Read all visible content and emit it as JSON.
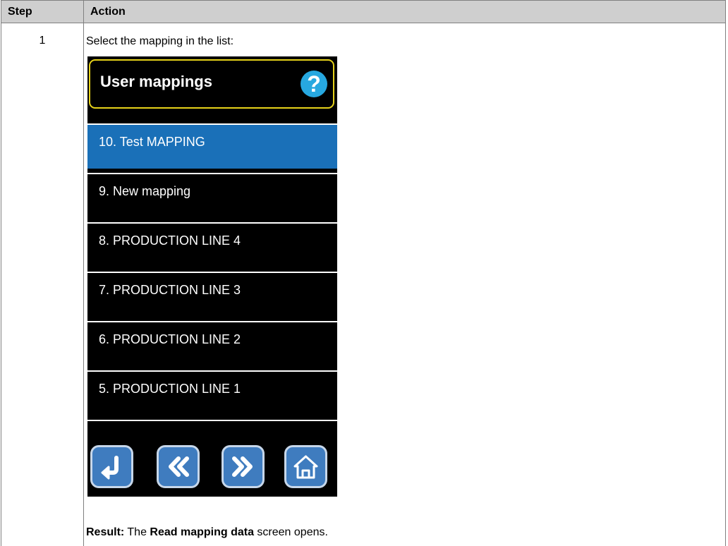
{
  "table": {
    "header_step": "Step",
    "header_action": "Action",
    "step_number": "1",
    "instruction": "Select the mapping in the list:",
    "result_label": "Result:",
    "result_pre": " The ",
    "result_bold": "Read mapping data",
    "result_post": " screen opens."
  },
  "device": {
    "title": "User mappings",
    "help_glyph": "?",
    "items": [
      {
        "label": "10.  Test MAPPING",
        "selected": true
      },
      {
        "label": "9.  New mapping",
        "selected": false
      },
      {
        "label": "8.  PRODUCTION LINE 4",
        "selected": false
      },
      {
        "label": "7.  PRODUCTION LINE 3",
        "selected": false
      },
      {
        "label": "6. PRODUCTION LINE 2",
        "selected": false
      },
      {
        "label": "5. PRODUCTION LINE 1",
        "selected": false
      }
    ],
    "nav_buttons": [
      {
        "icon": "return-arrow-icon"
      },
      {
        "icon": "double-chevron-left-icon"
      },
      {
        "icon": "double-chevron-right-icon"
      },
      {
        "icon": "home-icon"
      }
    ],
    "colors": {
      "title_border": "#e6d21a",
      "help": "#27a8e0",
      "selected_item": "#1a70b8",
      "button": "#3f7cbf"
    }
  }
}
